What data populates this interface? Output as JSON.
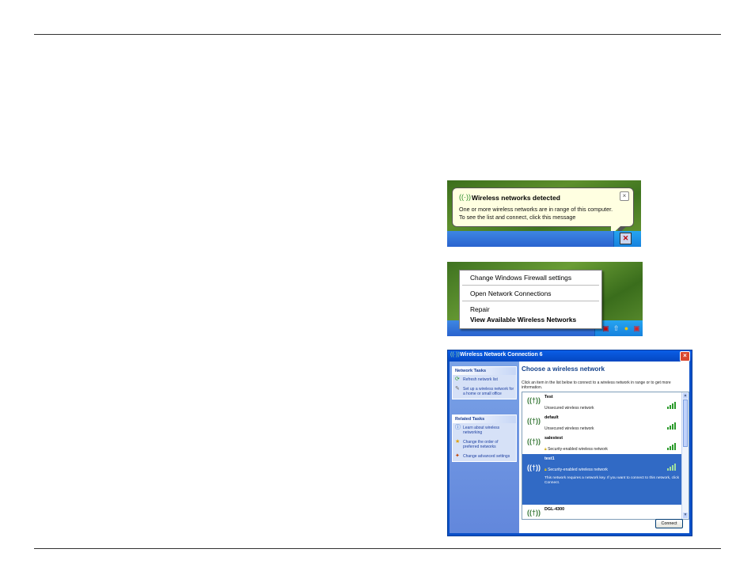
{
  "balloon": {
    "title": "Wireless networks detected",
    "close": "×",
    "line1": "One or more wireless networks are in range of this computer.",
    "line2": "To see the list and connect, click this message"
  },
  "context_menu": {
    "items": [
      "Change Windows Firewall settings",
      "Open Network Connections",
      "Repair",
      "View Available Wireless Networks"
    ]
  },
  "dialog": {
    "title": "Wireless Network Connection 6",
    "close": "×",
    "network_tasks_header": "Network Tasks",
    "network_tasks": [
      {
        "label": "Refresh network list",
        "icon": "refresh-icon"
      },
      {
        "label": "Set up a wireless network for a home or small office",
        "icon": "setup-icon"
      }
    ],
    "related_tasks_header": "Related Tasks",
    "related_tasks": [
      {
        "label": "Learn about wireless networking",
        "icon": "info-icon"
      },
      {
        "label": "Change the order of preferred networks",
        "icon": "star-icon"
      },
      {
        "label": "Change advanced settings",
        "icon": "settings-icon"
      }
    ],
    "main_title": "Choose a wireless network",
    "main_desc": "Click an item in the list below to connect to a wireless network in range or to get more information.",
    "networks": [
      {
        "name": "Test",
        "status": "Unsecured wireless network",
        "signal": 4
      },
      {
        "name": "default",
        "status": "Unsecured wireless network",
        "signal": 4
      },
      {
        "name": "salestest",
        "status": "Security-enabled wireless network",
        "signal": 4
      },
      {
        "name": "test1",
        "status": "Security-enabled wireless network",
        "signal": 3,
        "selected": true,
        "desc": "This network requires a network key. If you want to connect to this network, click Connect."
      },
      {
        "name": "DGL-4300",
        "status": "",
        "signal": 4
      }
    ],
    "connect_label": "Connect"
  },
  "colors": {
    "taskbar": "#2a63cf",
    "selection": "#316ac5",
    "dialog_frame": "#0a50c8"
  }
}
